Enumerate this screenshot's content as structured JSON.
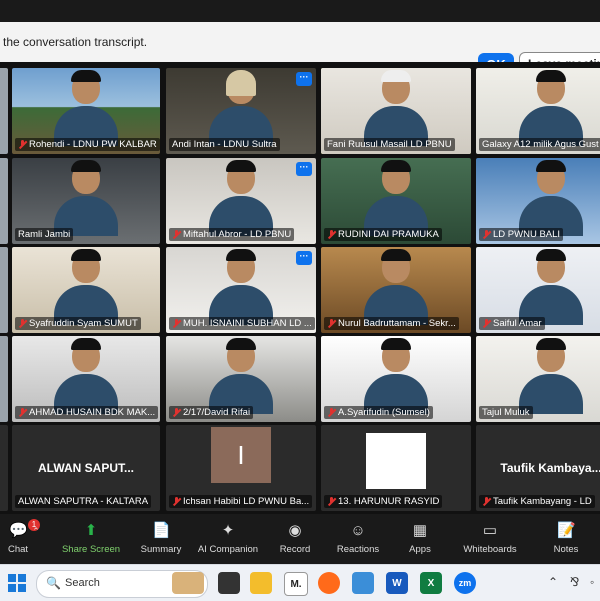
{
  "banner": {
    "text": "the conversation transcript.",
    "ok_label": "OK",
    "leave_label": "Leave meeting"
  },
  "participants": [
    {
      "name": "Rohendi - LDNU PW KALBAR",
      "muted": true,
      "more": false,
      "active": false
    },
    {
      "name": "Andi Intan - LDNU Sultra",
      "muted": false,
      "more": true,
      "active": false
    },
    {
      "name": "Fani Ruusul Masail LD PBNU",
      "muted": false,
      "more": false,
      "active": true
    },
    {
      "name": "Galaxy A12 milik Agus Gust",
      "muted": false,
      "more": false,
      "active": false
    },
    {
      "name": "Ramli Jambi",
      "muted": false,
      "more": false,
      "active": false
    },
    {
      "name": "Miftahul Abror - LD PBNU",
      "muted": true,
      "more": true,
      "active": false
    },
    {
      "name": "RUDINI DAI PRAMUKA",
      "muted": true,
      "more": false,
      "active": false
    },
    {
      "name": "LD PWNU BALI",
      "muted": true,
      "more": false,
      "active": false
    },
    {
      "name": "Syafruddin Syam SUMUT",
      "muted": true,
      "more": false,
      "active": false
    },
    {
      "name": "MUH. ISNAINI SUBHAN LD ...",
      "muted": true,
      "more": true,
      "active": false
    },
    {
      "name": "Nurul Badruttamam - Sekr...",
      "muted": true,
      "more": false,
      "active": false
    },
    {
      "name": "Saiful Amar",
      "muted": true,
      "more": false,
      "active": false
    },
    {
      "name": "AHMAD HUSAIN BDK MAK...",
      "muted": true,
      "more": false,
      "active": false
    },
    {
      "name": "2/17/David Rifai",
      "muted": true,
      "more": false,
      "active": false
    },
    {
      "name": "A.Syarifudin (Sumsel)",
      "muted": true,
      "more": false,
      "active": false
    },
    {
      "name": "Tajul Muluk",
      "muted": false,
      "more": false,
      "active": false
    },
    {
      "name": "ALWAN SAPUTRA - KALTARA",
      "muted": false,
      "more": false,
      "active": false,
      "big": "ALWAN SAPUT..."
    },
    {
      "name": "Ichsan Habibi LD PWNU Ba...",
      "muted": true,
      "more": false,
      "active": false,
      "big": "I"
    },
    {
      "name": "13. HARUNUR RASYID",
      "muted": true,
      "more": false,
      "active": false
    },
    {
      "name": "Taufik Kambayang - LD",
      "muted": true,
      "more": false,
      "active": false,
      "big": "Taufik  Kambaya..."
    }
  ],
  "toolbar": {
    "chat": "Chat",
    "chat_badge": "1",
    "share": "Share Screen",
    "summary": "Summary",
    "ai": "AI Companion",
    "record": "Record",
    "reactions": "Reactions",
    "apps": "Apps",
    "whiteboards": "Whiteboards",
    "notes": "Notes"
  },
  "taskbar": {
    "search_placeholder": "Search",
    "apps": [
      "M.",
      "W",
      "X",
      "zm"
    ]
  },
  "colors": {
    "accent": "#0e72ed",
    "active_border": "#cfe34d",
    "mute": "#e0322f",
    "share_green": "#7fd16d"
  }
}
